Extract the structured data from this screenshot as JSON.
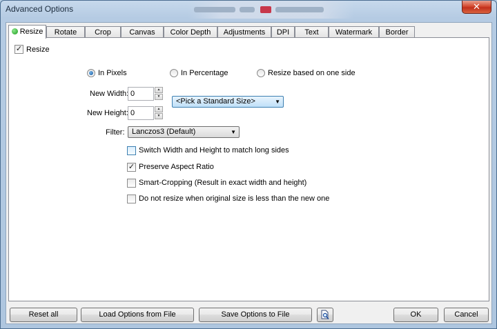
{
  "window": {
    "title": "Advanced Options",
    "close_glyph": "✕"
  },
  "tabs": [
    {
      "label": "Resize",
      "active": true
    },
    {
      "label": "Rotate"
    },
    {
      "label": "Crop"
    },
    {
      "label": "Canvas"
    },
    {
      "label": "Color Depth"
    },
    {
      "label": "Adjustments"
    },
    {
      "label": "DPI"
    },
    {
      "label": "Text"
    },
    {
      "label": "Watermark"
    },
    {
      "label": "Border"
    }
  ],
  "resize": {
    "enable_label": "Resize",
    "enable_checked": true,
    "modes": [
      {
        "label": "In Pixels",
        "selected": true
      },
      {
        "label": "In Percentage",
        "selected": false
      },
      {
        "label": "Resize based on one side",
        "selected": false
      }
    ],
    "width_label": "New Width:",
    "width_value": "0",
    "height_label": "New Height:",
    "height_value": "0",
    "standard_size": "<Pick a Standard Size>",
    "filter_label": "Filter:",
    "filter_value": "Lanczos3 (Default)",
    "options": [
      {
        "label": "Switch Width and Height to match long sides",
        "checked": false
      },
      {
        "label": "Preserve Aspect Ratio",
        "checked": true
      },
      {
        "label": "Smart-Cropping (Result in exact width and height)",
        "checked": false
      },
      {
        "label": "Do not resize when original size is less than the new one",
        "checked": false
      }
    ]
  },
  "buttons": {
    "reset_all": "Reset all",
    "load": "Load Options from File",
    "save": "Save Options to File",
    "preview_icon": "magnifier-page-icon",
    "ok": "OK",
    "cancel": "Cancel"
  },
  "colors": {
    "accent": "#3c7fb1",
    "active_dot": "#1a9a1a",
    "close": "#c2301b"
  }
}
